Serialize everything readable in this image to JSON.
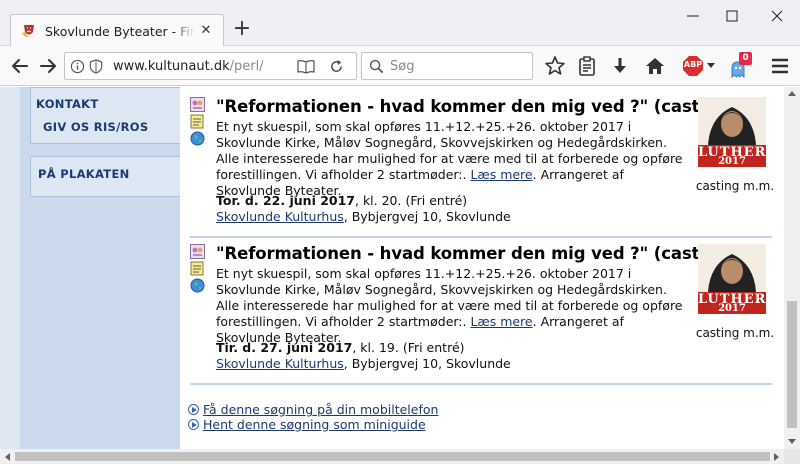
{
  "browser": {
    "tab_title": "Skovlunde Byteater - Find de",
    "url_host": "www.kultunaut.dk",
    "url_path": "/perl/stec",
    "search_placeholder": "Søg",
    "notification_count": "0",
    "adblock_label": "ABP",
    "colors": {
      "tab_bg": "#fafafa",
      "toolbar_bg": "#f9f9fa",
      "adblock_red": "#d92e2e",
      "badge_red": "#e22850"
    }
  },
  "sidebar": {
    "box1": {
      "items": [
        "KONTAKT",
        "GIV OS RIS/ROS"
      ]
    },
    "box2": {
      "items": [
        "PÅ PLAKATEN"
      ]
    }
  },
  "events": [
    {
      "title": "\"Reformationen - hvad kommer den mig ved ?\" (casting).",
      "description": "Et nyt skuespil, som skal opføres 11.+12.+25.+26. oktober 2017 i Skovlunde Kirke, Måløv Sognegård, Skovvejskirken og Hedegårdskirken. Alle interesserede har mulighed for at være med til at forberede og opføre forestillingen. Vi afholder 2 startmøder:. ",
      "read_more": "Læs mere",
      "arranger": ". Arrangeret af Skovlunde Byteater.",
      "date_bold": "Tor. d. 22. juni 2017",
      "time": ", kl. 20. (Fri entré)",
      "venue_link": "Skovlunde Kulturhus",
      "venue_address": ", Bybjergvej 10, Skovlunde",
      "image_text_top": "LUTHER",
      "image_text_bottom": "2017",
      "caption": "casting m.m."
    },
    {
      "title": "\"Reformationen - hvad kommer den mig ved ?\" (casting).",
      "description": "Et nyt skuespil, som skal opføres 11.+12.+25.+26. oktober 2017 i Skovlunde Kirke, Måløv Sognegård, Skovvejskirken og Hedegårdskirken. Alle interesserede har mulighed for at være med til at forberede og opføre forestillingen. Vi afholder 2 startmøder:. ",
      "read_more": "Læs mere",
      "arranger": ". Arrangeret af Skovlunde Byteater.",
      "date_bold": "Tir. d. 27. juni 2017",
      "time": ", kl. 19. (Fri entré)",
      "venue_link": "Skovlunde Kulturhus",
      "venue_address": ", Bybjergvej 10, Skovlunde",
      "image_text_top": "LUTHER",
      "image_text_bottom": "2017",
      "caption": "casting m.m."
    }
  ],
  "footer_links": [
    "Få denne søgning på din mobiltelefon",
    "Hent denne søgning som miniguide"
  ]
}
